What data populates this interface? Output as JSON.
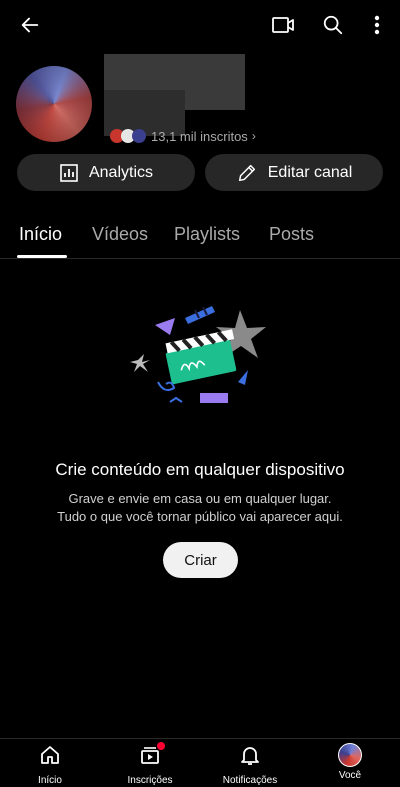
{
  "topbar": {
    "back_icon": "arrow-back-icon",
    "cast_icon": "video-camera-icon",
    "search_icon": "search-icon",
    "more_icon": "more-vert-icon"
  },
  "channel": {
    "subscribers": "13,1 mil inscritos",
    "subscribers_chevron": "›"
  },
  "actions": {
    "analytics_label": "Analytics",
    "edit_label": "Editar canal"
  },
  "tabs": [
    {
      "label": "Início",
      "active": true
    },
    {
      "label": "Vídeos",
      "active": false
    },
    {
      "label": "Playlists",
      "active": false
    },
    {
      "label": "Posts",
      "active": false
    }
  ],
  "empty_state": {
    "title": "Crie conteúdo em qualquer dispositivo",
    "line1": "Grave e envie em casa ou em qualquer lugar.",
    "line2": "Tudo o que você tornar público vai aparecer aqui.",
    "create_label": "Criar"
  },
  "bottom_nav": [
    {
      "label": "Início",
      "icon": "home-icon"
    },
    {
      "label": "Inscrições",
      "icon": "subscriptions-icon"
    },
    {
      "label": "Notificações",
      "icon": "bell-icon"
    },
    {
      "label": "Você",
      "icon": "avatar"
    }
  ],
  "colors": {
    "background": "#000000",
    "button_bg": "#272727",
    "muted_text": "#aaaaaa",
    "notification_dot": "#ff0033",
    "illustration_teal": "#1dbf8f",
    "illustration_blue": "#3b6fe0",
    "illustration_purple": "#9a7cf0"
  }
}
